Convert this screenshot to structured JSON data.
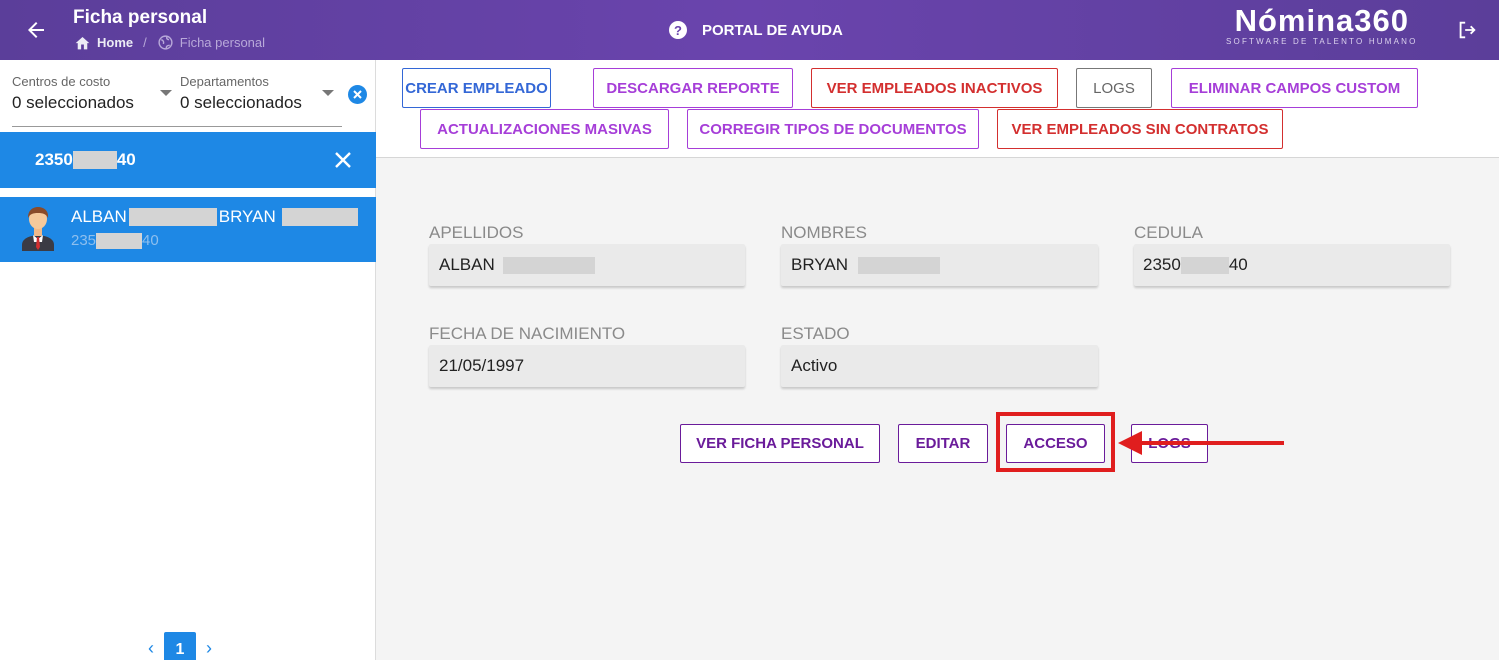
{
  "header": {
    "title": "Ficha personal",
    "breadcrumb": {
      "home": "Home",
      "separator": "/",
      "current": "Ficha personal"
    },
    "help_label": "PORTAL DE AYUDA",
    "logo": {
      "main": "Nómina360",
      "sub": "SOFTWARE DE TALENTO HUMANO"
    }
  },
  "sidebar": {
    "filters": [
      {
        "label": "Centros de costo",
        "value": "0 seleccionados"
      },
      {
        "label": "Departamentos",
        "value": "0 seleccionados"
      }
    ],
    "search": {
      "prefix": "2350",
      "suffix": "40"
    },
    "employee": {
      "surname": "ALBAN",
      "name": "BRYAN",
      "id_prefix": "235",
      "id_suffix": "40"
    },
    "pagination": {
      "prev": "‹",
      "page": "1",
      "next": "›"
    }
  },
  "toolbar": {
    "crear": "CREAR EMPLEADO",
    "descargar": "DESCARGAR REPORTE",
    "inactivos": "VER EMPLEADOS INACTIVOS",
    "logs": "LOGS",
    "eliminar": "ELIMINAR CAMPOS CUSTOM",
    "masivas": "ACTUALIZACIONES MASIVAS",
    "corregir": "CORREGIR TIPOS DE DOCUMENTOS",
    "sin_contratos": "VER EMPLEADOS SIN CONTRATOS"
  },
  "form": {
    "apellidos": {
      "label": "APELLIDOS",
      "value": "ALBAN"
    },
    "nombres": {
      "label": "NOMBRES",
      "value": "BRYAN"
    },
    "cedula": {
      "label": "CEDULA",
      "prefix": "2350",
      "suffix": "40"
    },
    "fecha": {
      "label": "FECHA DE NACIMIENTO",
      "value": "21/05/1997"
    },
    "estado": {
      "label": "ESTADO",
      "value": "Activo"
    }
  },
  "actions": {
    "ver_ficha": "VER FICHA PERSONAL",
    "editar": "EDITAR",
    "acceso": "ACCESO",
    "logs": "LOGS"
  },
  "colors": {
    "header": "#6a44ad",
    "primary_blue": "#1e88e5",
    "annotation_red": "#e01e1e"
  }
}
